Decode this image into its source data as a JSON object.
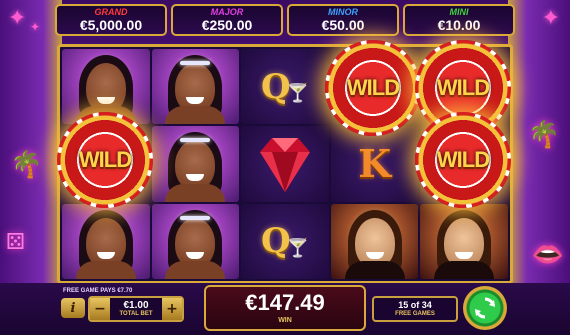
{
  "jackpots": [
    {
      "name": "GRAND",
      "value": "€5,000.00",
      "color": "#ff3a3a"
    },
    {
      "name": "MAJOR",
      "value": "€250.00",
      "color": "#e040e0"
    },
    {
      "name": "MINOR",
      "value": "€50.00",
      "color": "#40a0ff"
    },
    {
      "name": "MINI",
      "value": "€10.00",
      "color": "#40d040"
    }
  ],
  "reels": {
    "wild_label": "WILD",
    "q_symbol": "Q",
    "k_symbol": "K"
  },
  "bottom": {
    "free_game_pays": "FREE GAME PAYS €7.70",
    "info_label": "i",
    "bet_minus": "−",
    "bet_plus": "+",
    "total_bet_value": "€1.00",
    "total_bet_label": "TOTAL BET",
    "win_value": "€147.49",
    "win_label": "WIN",
    "free_games_count": "15 of 34",
    "free_games_label": "FREE GAMES"
  },
  "colors": {
    "gold": "#d9a93a",
    "spin_green": "#2ecc4a"
  }
}
